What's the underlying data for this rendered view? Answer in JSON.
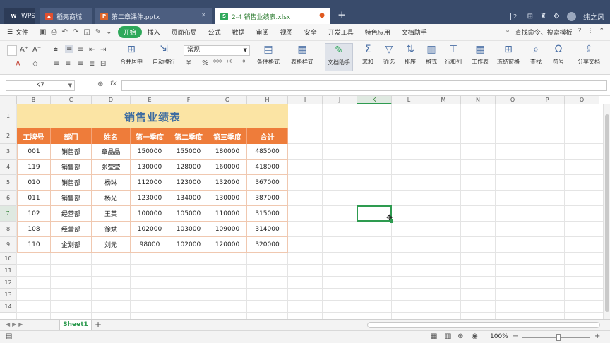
{
  "app": {
    "name": "WPS"
  },
  "tabs": [
    {
      "label": "WPS"
    },
    {
      "label": "稻壳商城"
    },
    {
      "label": "第二章课件.pptx"
    },
    {
      "label": "2-4 销售业绩表.xlsx",
      "active": true
    }
  ],
  "window": {
    "badge": "2",
    "user": "纬之风"
  },
  "menu": {
    "file": "文件",
    "items": [
      "开始",
      "插入",
      "页面布局",
      "公式",
      "数据",
      "审阅",
      "视图",
      "安全",
      "开发工具",
      "特色应用",
      "文档助手"
    ],
    "active": "开始",
    "search": "查找命令、搜索模板",
    "help": "?"
  },
  "ribbon": {
    "merge": "合并居中",
    "wrap": "自动换行",
    "number_format": "常规",
    "conditional": "条件格式",
    "table_style": "表格样式",
    "doc_helper": "文档助手",
    "sum": "求和",
    "filter": "筛选",
    "sort": "排序",
    "format": "格式",
    "rowcol": "行和列",
    "worksheet": "工作表",
    "freeze": "冻结窗格",
    "find": "查找",
    "symbol": "符号",
    "share": "分享文档"
  },
  "formula_bar": {
    "name_box": "K7",
    "fx": "fx",
    "formula": ""
  },
  "sheet": {
    "columns": [
      "B",
      "C",
      "D",
      "E",
      "F",
      "G",
      "H",
      "I",
      "J",
      "K",
      "L",
      "M",
      "N",
      "O",
      "P",
      "Q"
    ],
    "selected_column": "K",
    "rows": [
      "1",
      "2",
      "3",
      "4",
      "5",
      "6",
      "7",
      "8",
      "9",
      "10",
      "11",
      "12",
      "13",
      "14"
    ],
    "selected_row": "7",
    "title": "销售业绩表",
    "headers": [
      "工牌号",
      "部门",
      "姓名",
      "第一季度",
      "第二季度",
      "第三季度",
      "合计"
    ],
    "data": [
      [
        "001",
        "销售部",
        "章晶晶",
        "150000",
        "155000",
        "180000",
        "485000"
      ],
      [
        "119",
        "销售部",
        "张莹莹",
        "130000",
        "128000",
        "160000",
        "418000"
      ],
      [
        "010",
        "销售部",
        "杨琳",
        "112000",
        "123000",
        "132000",
        "367000"
      ],
      [
        "011",
        "销售部",
        "杨光",
        "123000",
        "134000",
        "130000",
        "387000"
      ],
      [
        "102",
        "经营部",
        "王英",
        "100000",
        "105000",
        "110000",
        "315000"
      ],
      [
        "108",
        "经营部",
        "徐斌",
        "102000",
        "103000",
        "109000",
        "314000"
      ],
      [
        "110",
        "企划部",
        "刘元",
        "98000",
        "102000",
        "120000",
        "320000"
      ]
    ],
    "colors": {
      "title_fill": "#fbe4a4",
      "title_text": "#3f6da1",
      "header_fill": "#ee7c3a",
      "border": "#f0c8b0",
      "accent": "#2e9b50"
    }
  },
  "sheet_tabs": {
    "active": "Sheet1",
    "add": "+"
  },
  "status": {
    "zoom": "100%"
  }
}
